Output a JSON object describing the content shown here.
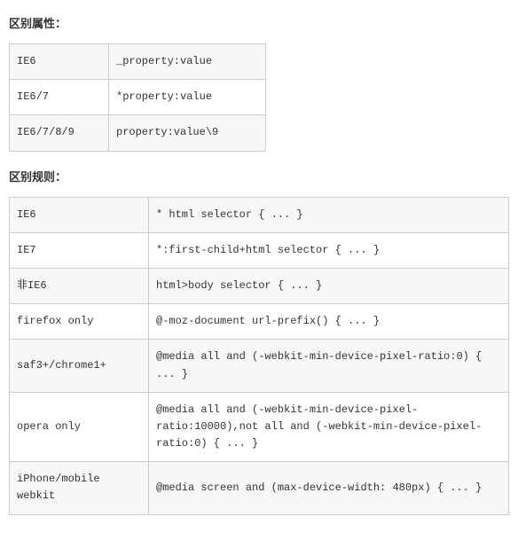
{
  "section1": {
    "heading": "区别属性：",
    "rows": [
      {
        "label": "IE6",
        "value": "_property:value"
      },
      {
        "label": "IE6/7",
        "value": "*property:value"
      },
      {
        "label": "IE6/7/8/9",
        "value": "property:value\\9"
      }
    ]
  },
  "section2": {
    "heading": "区别规则：",
    "rows": [
      {
        "label": "IE6",
        "value": "* html selector { ... }"
      },
      {
        "label": "IE7",
        "value": "*:first-child+html selector { ... }"
      },
      {
        "label": "非IE6",
        "value": "html>body selector { ... }"
      },
      {
        "label": "firefox only",
        "value": "@-moz-document url-prefix() { ... }"
      },
      {
        "label": "saf3+/chrome1+",
        "value": "@media all and (-webkit-min-device-pixel-ratio:0) { ... }"
      },
      {
        "label": "opera only",
        "value": "@media all and (-webkit-min-device-pixel-ratio:10000),not all and (-webkit-min-device-pixel-ratio:0) { ... }"
      },
      {
        "label": "iPhone/mobile webkit",
        "value": "@media screen and (max-device-width: 480px) { ... }"
      }
    ]
  }
}
